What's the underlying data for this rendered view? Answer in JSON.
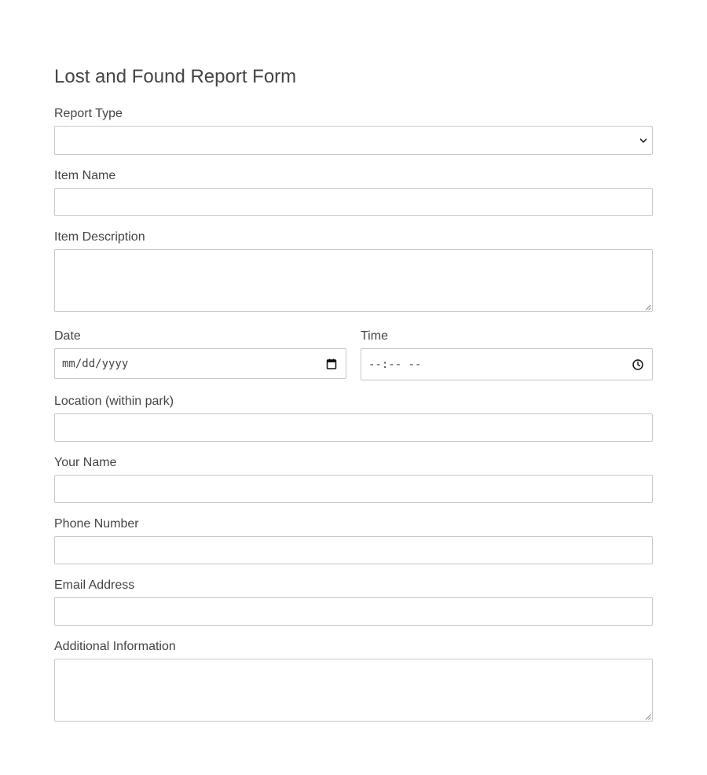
{
  "form": {
    "title": "Lost and Found Report Form",
    "report_type": {
      "label": "Report Type",
      "value": ""
    },
    "item_name": {
      "label": "Item Name",
      "value": ""
    },
    "item_description": {
      "label": "Item Description",
      "value": ""
    },
    "date": {
      "label": "Date",
      "placeholder": "mm/dd/yyyy"
    },
    "time": {
      "label": "Time",
      "placeholder": "--:-- --"
    },
    "location": {
      "label": "Location (within park)",
      "value": ""
    },
    "your_name": {
      "label": "Your Name",
      "value": ""
    },
    "phone": {
      "label": "Phone Number",
      "value": ""
    },
    "email": {
      "label": "Email Address",
      "value": ""
    },
    "additional_info": {
      "label": "Additional Information",
      "value": ""
    }
  },
  "icons": {
    "select_arrow": "chevron-down-icon",
    "date_picker": "calendar-icon",
    "time_picker": "clock-icon",
    "resize": "resize-grip-icon"
  },
  "colors": {
    "text": "#444444",
    "border": "#c8c8c8",
    "background": "#ffffff"
  }
}
